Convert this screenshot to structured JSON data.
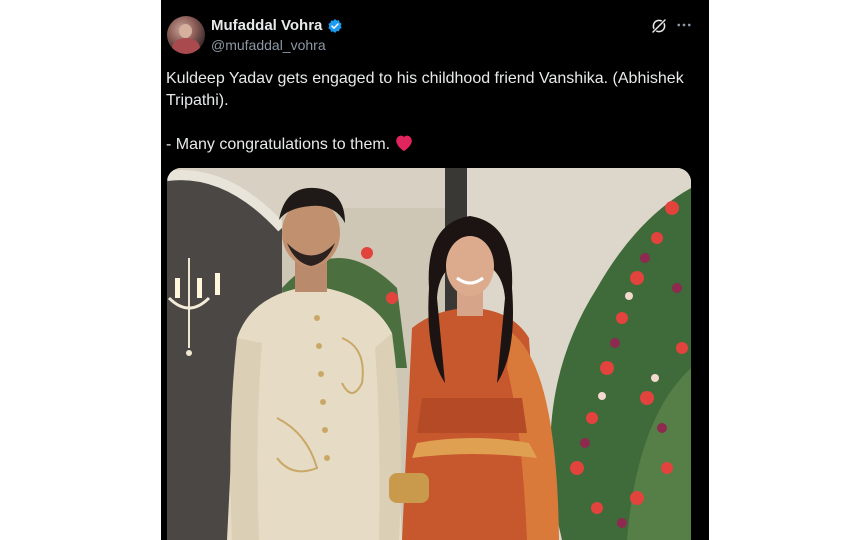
{
  "author": {
    "name": "Mufaddal Vohra",
    "handle": "@mufaddal_vohra",
    "verified": true
  },
  "tweet": {
    "line1": "Kuldeep Yadav gets engaged to his childhood friend Vanshika. (Abhishek Tripathi).",
    "line2": "- Many congratulations to them."
  },
  "icons": {
    "verified": "verified-badge-icon",
    "grok": "grok-icon",
    "more": "more-options-icon",
    "heart": "red-heart-icon"
  },
  "colors": {
    "background": "#000000",
    "text": "#e7e9ea",
    "secondary_text": "#8b98a5",
    "verified_blue": "#1d9bf0",
    "heart_red": "#e0245e"
  }
}
